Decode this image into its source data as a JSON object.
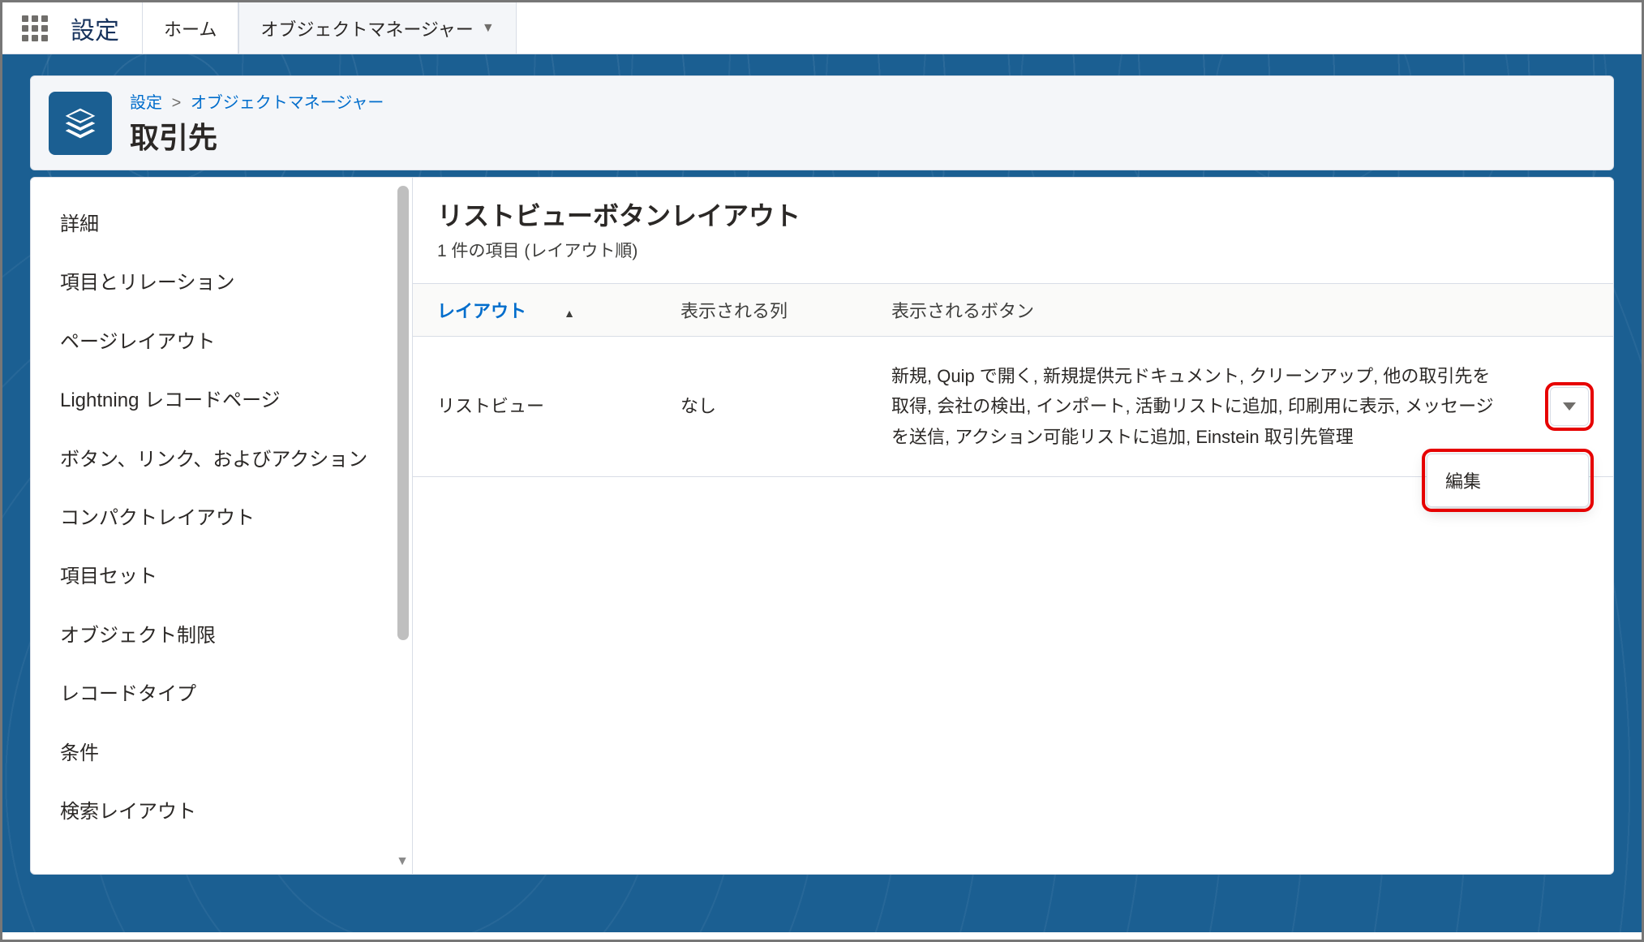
{
  "topbar": {
    "app_title": "設定",
    "tabs": [
      "ホーム",
      "オブジェクトマネージャー"
    ]
  },
  "breadcrumb": {
    "root": "設定",
    "current": "オブジェクトマネージャー"
  },
  "page": {
    "object_label": "取引先"
  },
  "sidebar": {
    "items": [
      "詳細",
      "項目とリレーション",
      "ページレイアウト",
      "Lightning レコードページ",
      "ボタン、リンク、およびアクション",
      "コンパクトレイアウト",
      "項目セット",
      "オブジェクト制限",
      "レコードタイプ",
      "条件",
      "検索レイアウト"
    ]
  },
  "main": {
    "title": "リストビューボタンレイアウト",
    "subtitle": "1 件の項目 (レイアウト順)",
    "columns": {
      "layout": "レイアウト",
      "displayed_cols": "表示される列",
      "displayed_buttons": "表示されるボタン"
    },
    "rows": [
      {
        "layout": "リストビュー",
        "displayed_cols": "なし",
        "displayed_buttons": "新規, Quip で開く, 新規提供元ドキュメント, クリーンアップ, 他の取引先を取得, 会社の検出, インポート, 活動リストに追加, 印刷用に表示, メッセージを送信, アクション可能リストに追加, Einstein 取引先管理"
      }
    ],
    "dropdown": {
      "edit": "編集"
    }
  }
}
